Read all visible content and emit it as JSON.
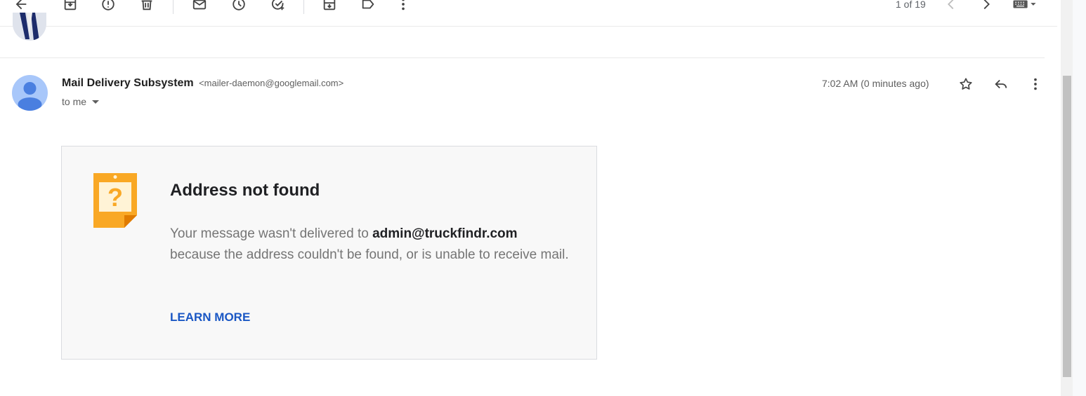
{
  "toolbar": {
    "icons": [
      "back-arrow-icon",
      "archive-icon",
      "report-spam-icon",
      "delete-icon",
      "mark-unread-icon",
      "snooze-icon",
      "add-to-tasks-icon",
      "move-to-icon",
      "label-icon",
      "more-vert-icon"
    ],
    "pager_text": "1 of 19",
    "input_tools_icon": "keyboard-icon"
  },
  "message": {
    "sender_name": "Mail Delivery Subsystem",
    "sender_email": "<mailer-daemon@googlemail.com>",
    "recipient_text": "to me",
    "timestamp": "7:02 AM (0 minutes ago)"
  },
  "bounce_card": {
    "title": "Address not found",
    "body_prefix": "Your message wasn't delivered to ",
    "address": "admin@truckfindr.com",
    "body_suffix": "because the address couldn't be found, or is unable to receive mail.",
    "link": "LEARN MORE",
    "icon_glyph": "?"
  },
  "colors": {
    "icon_orange": "#f9a825",
    "link_blue": "#1a57c4",
    "avatar_blue": "#a8c7fa"
  }
}
